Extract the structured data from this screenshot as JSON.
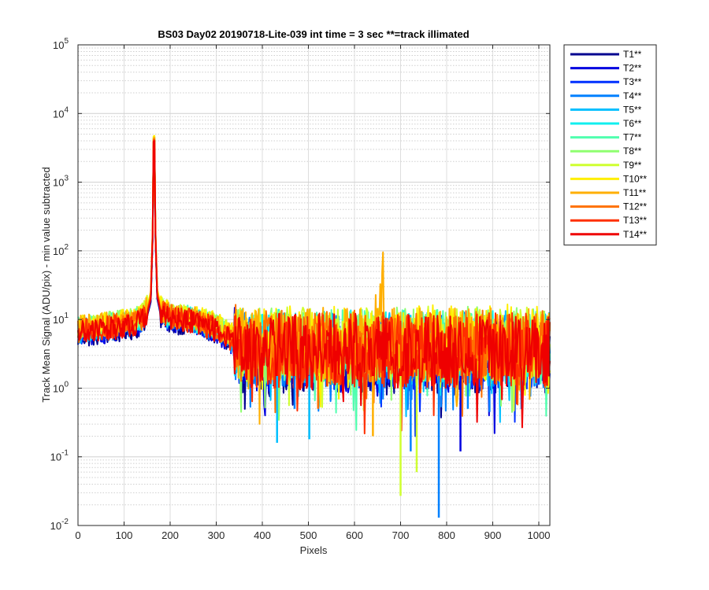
{
  "chart_data": {
    "type": "line",
    "title": "BS03 Day02 20190718-Lite-039 int time = 3 sec    **=track illimated",
    "xlabel": "Pixels",
    "ylabel": "Track Mean Signal (ADU/pix) - min value subtracted",
    "xlim": [
      0,
      1024
    ],
    "ylim": [
      0.01,
      100000
    ],
    "yscale": "log",
    "grid": "major and minor",
    "legend_position": "outside-top-right",
    "x_ticks": [
      0,
      100,
      200,
      300,
      400,
      500,
      600,
      700,
      800,
      900,
      1000
    ],
    "y_ticks": [
      {
        "value": 0.01,
        "base": "10",
        "exp": "-2"
      },
      {
        "value": 0.1,
        "base": "10",
        "exp": "-1"
      },
      {
        "value": 1,
        "base": "10",
        "exp": "0"
      },
      {
        "value": 10,
        "base": "10",
        "exp": "1"
      },
      {
        "value": 100,
        "base": "10",
        "exp": "2"
      },
      {
        "value": 1000,
        "base": "10",
        "exp": "3"
      },
      {
        "value": 10000,
        "base": "10",
        "exp": "4"
      },
      {
        "value": 100000,
        "base": "10",
        "exp": "5"
      }
    ],
    "x": [
      0,
      25,
      50,
      75,
      100,
      125,
      140,
      150,
      158,
      162,
      165,
      168,
      172,
      180,
      190,
      200,
      225,
      250,
      275,
      300,
      320,
      340,
      350,
      360,
      380,
      400,
      430,
      460,
      490,
      520,
      550,
      580,
      610,
      640,
      663,
      665,
      667,
      690,
      720,
      750,
      780,
      810,
      840,
      870,
      900,
      930,
      960,
      990,
      1024
    ],
    "series": [
      {
        "name": "T1**",
        "color": "#00008f",
        "values": [
          5.8,
          6.0,
          6.3,
          6.7,
          7.0,
          7.8,
          9.0,
          11.0,
          18,
          150,
          17000,
          160,
          20,
          11.0,
          10.0,
          9.2,
          9.0,
          8.5,
          7.5,
          6.5,
          5.2,
          4.0,
          3.2,
          3.0,
          2.8,
          3.0,
          2.9,
          3.1,
          2.8,
          3.0,
          2.9,
          2.8,
          3.0,
          2.7,
          2.9,
          3.0,
          2.8,
          2.9,
          2.8,
          2.9,
          3.0,
          2.8,
          3.0,
          2.9,
          3.0,
          3.1,
          2.9,
          3.0,
          2.9
        ]
      },
      {
        "name": "T2**",
        "color": "#0000df",
        "values": [
          6.0,
          6.2,
          6.6,
          7.0,
          7.4,
          8.2,
          9.4,
          11.5,
          19,
          160,
          18000,
          170,
          21,
          11.5,
          10.4,
          9.6,
          9.3,
          8.8,
          7.8,
          6.8,
          5.4,
          4.2,
          3.4,
          3.2,
          3.0,
          3.2,
          3.1,
          3.3,
          3.0,
          3.2,
          3.1,
          3.0,
          3.2,
          2.9,
          3.1,
          3.2,
          3.0,
          3.1,
          3.0,
          3.1,
          3.2,
          3.0,
          3.2,
          3.1,
          3.2,
          3.3,
          3.1,
          3.2,
          3.1
        ]
      },
      {
        "name": "T3**",
        "color": "#0030ff",
        "values": [
          6.2,
          6.5,
          6.9,
          7.3,
          7.7,
          8.5,
          9.8,
          12.0,
          20,
          170,
          19000,
          180,
          22,
          12.0,
          10.8,
          10.0,
          9.7,
          9.1,
          8.0,
          7.0,
          5.6,
          4.4,
          3.6,
          3.4,
          3.2,
          3.4,
          3.3,
          3.5,
          3.2,
          3.4,
          3.3,
          3.2,
          3.4,
          3.1,
          3.3,
          3.4,
          3.2,
          3.3,
          3.2,
          3.3,
          3.4,
          3.2,
          3.4,
          3.3,
          3.4,
          3.5,
          3.3,
          3.4,
          3.3
        ]
      },
      {
        "name": "T4**",
        "color": "#0080ff",
        "values": [
          6.5,
          6.8,
          7.2,
          7.6,
          8.0,
          8.8,
          10.2,
          12.5,
          21,
          175,
          19500,
          185,
          23,
          12.5,
          11.2,
          10.4,
          10.0,
          9.4,
          8.3,
          7.2,
          5.8,
          4.6,
          3.8,
          3.6,
          3.4,
          3.6,
          3.5,
          3.7,
          3.4,
          3.6,
          3.5,
          3.4,
          3.6,
          3.3,
          3.5,
          3.6,
          3.4,
          3.5,
          3.4,
          3.5,
          3.6,
          3.4,
          3.6,
          3.5,
          3.6,
          3.7,
          3.5,
          3.6,
          3.5
        ]
      },
      {
        "name": "T5**",
        "color": "#00bfff",
        "values": [
          6.8,
          7.1,
          7.5,
          7.9,
          8.3,
          9.1,
          10.6,
          13.0,
          22,
          180,
          20000,
          190,
          24,
          13.0,
          11.6,
          10.8,
          10.3,
          9.7,
          8.5,
          7.4,
          6.0,
          4.8,
          4.0,
          3.8,
          3.6,
          3.8,
          3.7,
          3.9,
          3.6,
          3.8,
          3.7,
          3.6,
          3.8,
          3.5,
          3.7,
          3.8,
          3.6,
          3.7,
          3.6,
          3.7,
          3.8,
          3.6,
          3.8,
          3.7,
          3.8,
          3.9,
          3.7,
          3.8,
          3.7
        ]
      },
      {
        "name": "T6**",
        "color": "#10efef",
        "values": [
          7.0,
          7.4,
          7.8,
          8.2,
          8.6,
          9.4,
          11.0,
          13.5,
          23,
          185,
          20500,
          195,
          25,
          13.5,
          12.0,
          11.2,
          10.6,
          10.0,
          8.8,
          7.6,
          6.2,
          5.0,
          4.2,
          4.0,
          3.8,
          4.0,
          3.9,
          4.1,
          3.8,
          4.0,
          3.9,
          3.8,
          4.0,
          3.7,
          3.9,
          4.0,
          3.8,
          3.9,
          3.8,
          3.9,
          4.0,
          3.8,
          4.0,
          3.9,
          4.0,
          4.1,
          3.9,
          4.0,
          3.9
        ]
      },
      {
        "name": "T7**",
        "color": "#50ffaf",
        "values": [
          7.3,
          7.7,
          8.1,
          8.5,
          8.9,
          9.7,
          11.4,
          14.0,
          24,
          190,
          21000,
          200,
          26,
          14.0,
          12.4,
          11.6,
          11.0,
          10.3,
          9.0,
          7.8,
          6.4,
          5.2,
          4.4,
          4.2,
          4.0,
          4.2,
          4.1,
          4.3,
          4.0,
          4.2,
          4.1,
          4.0,
          4.2,
          3.9,
          4.1,
          4.2,
          4.0,
          4.1,
          4.0,
          4.1,
          4.2,
          4.0,
          4.2,
          4.1,
          4.2,
          4.3,
          4.1,
          4.2,
          4.1
        ]
      },
      {
        "name": "T8**",
        "color": "#8fff70",
        "values": [
          7.6,
          8.0,
          8.4,
          8.8,
          9.2,
          10.0,
          11.8,
          14.5,
          25,
          195,
          21500,
          205,
          27,
          14.5,
          12.8,
          12.0,
          11.3,
          10.6,
          9.3,
          8.0,
          6.6,
          5.4,
          4.6,
          4.4,
          4.2,
          4.4,
          4.3,
          4.5,
          4.2,
          4.4,
          4.3,
          4.2,
          4.4,
          4.1,
          4.3,
          4.4,
          4.2,
          4.3,
          4.2,
          4.3,
          4.4,
          4.2,
          4.4,
          4.3,
          4.4,
          4.5,
          4.3,
          4.4,
          4.3
        ]
      },
      {
        "name": "T9**",
        "color": "#cfff30",
        "values": [
          7.8,
          8.2,
          8.6,
          9.0,
          9.4,
          10.2,
          12.0,
          14.8,
          25,
          198,
          22000,
          208,
          27,
          14.8,
          13.0,
          12.2,
          11.5,
          10.8,
          9.5,
          8.2,
          6.8,
          5.5,
          4.7,
          4.5,
          4.3,
          4.5,
          4.4,
          4.6,
          4.3,
          4.5,
          4.4,
          4.3,
          4.5,
          4.2,
          4.4,
          4.5,
          4.3,
          4.4,
          4.3,
          4.4,
          4.5,
          4.3,
          4.5,
          4.4,
          4.5,
          4.6,
          4.4,
          4.5,
          4.4
        ]
      },
      {
        "name": "T10**",
        "color": "#ffef00",
        "values": [
          8.0,
          8.4,
          8.8,
          9.2,
          9.6,
          10.4,
          12.2,
          15.0,
          26,
          200,
          22500,
          210,
          28,
          15.0,
          13.2,
          12.4,
          11.7,
          11.0,
          9.7,
          8.4,
          7.0,
          5.6,
          4.8,
          4.6,
          4.4,
          4.6,
          4.5,
          4.7,
          4.4,
          4.6,
          4.5,
          4.4,
          4.6,
          4.3,
          4.5,
          4.6,
          4.4,
          4.5,
          4.4,
          4.5,
          4.6,
          4.4,
          4.6,
          4.5,
          4.6,
          4.7,
          4.5,
          4.6,
          4.5
        ]
      },
      {
        "name": "T11**",
        "color": "#ffaf00",
        "values": [
          7.5,
          7.9,
          8.3,
          8.7,
          9.1,
          9.9,
          11.6,
          14.2,
          24,
          192,
          21000,
          202,
          26,
          14.2,
          12.6,
          11.8,
          11.2,
          10.5,
          9.2,
          7.9,
          6.5,
          5.3,
          4.5,
          4.3,
          4.1,
          4.3,
          4.2,
          4.4,
          4.1,
          4.3,
          4.2,
          4.1,
          4.3,
          4.0,
          42,
          4.3,
          4.1,
          4.2,
          4.1,
          4.2,
          4.3,
          4.1,
          4.3,
          4.2,
          4.3,
          4.4,
          4.2,
          4.3,
          4.2
        ]
      },
      {
        "name": "T12**",
        "color": "#ff7000",
        "values": [
          7.0,
          7.3,
          7.7,
          8.1,
          8.5,
          9.3,
          10.8,
          13.2,
          22,
          182,
          20000,
          192,
          24,
          13.2,
          11.8,
          11.0,
          10.5,
          9.9,
          8.7,
          7.5,
          6.1,
          4.9,
          4.1,
          3.9,
          3.7,
          3.9,
          3.8,
          4.0,
          3.7,
          3.9,
          3.8,
          3.7,
          3.9,
          3.6,
          3.8,
          3.9,
          3.7,
          3.8,
          3.7,
          3.8,
          3.9,
          3.7,
          3.9,
          3.8,
          3.9,
          4.0,
          3.8,
          3.9,
          3.8
        ]
      },
      {
        "name": "T13**",
        "color": "#ff3000",
        "values": [
          6.6,
          6.9,
          7.3,
          7.7,
          8.1,
          8.9,
          10.3,
          12.6,
          21,
          176,
          19000,
          186,
          23,
          12.6,
          11.3,
          10.5,
          10.1,
          9.5,
          8.4,
          7.3,
          5.9,
          4.7,
          3.9,
          3.7,
          3.5,
          3.7,
          3.6,
          3.8,
          3.5,
          3.7,
          3.6,
          3.5,
          3.7,
          3.4,
          3.6,
          3.7,
          3.5,
          3.6,
          3.5,
          3.6,
          3.7,
          3.5,
          3.7,
          3.6,
          3.7,
          3.8,
          3.6,
          3.7,
          3.6
        ]
      },
      {
        "name": "T14**",
        "color": "#ef0000",
        "values": [
          6.3,
          6.6,
          7.0,
          7.4,
          7.8,
          8.6,
          10.0,
          12.2,
          20,
          172,
          18500,
          182,
          22,
          12.2,
          11.0,
          10.2,
          9.8,
          9.3,
          8.2,
          7.1,
          5.7,
          4.5,
          3.7,
          3.5,
          3.3,
          3.5,
          3.4,
          3.6,
          3.3,
          3.5,
          3.4,
          3.3,
          3.5,
          3.2,
          3.4,
          3.5,
          3.3,
          3.4,
          3.3,
          3.4,
          3.5,
          3.3,
          3.5,
          3.4,
          3.5,
          3.6,
          3.4,
          3.5,
          3.4
        ]
      }
    ],
    "annotations": [
      {
        "x": 165,
        "value": 20000,
        "note": "main peak"
      },
      {
        "x": 665,
        "value": 42,
        "note": "secondary spike"
      }
    ],
    "dips": [
      {
        "x": 432,
        "value": 0.16,
        "color": "#00bfff"
      },
      {
        "x": 470,
        "value": 0.5,
        "color": "#0080ff"
      },
      {
        "x": 502,
        "value": 0.18,
        "color": "#00bfff"
      },
      {
        "x": 521,
        "value": 0.5,
        "color": "#ff7000"
      },
      {
        "x": 640,
        "value": 0.2,
        "color": "#ffaf00"
      },
      {
        "x": 700,
        "value": 0.027,
        "color": "#cfff30"
      },
      {
        "x": 722,
        "value": 0.12,
        "color": "#0080ff"
      },
      {
        "x": 735,
        "value": 0.06,
        "color": "#cfff30"
      },
      {
        "x": 783,
        "value": 0.013,
        "color": "#0080ff"
      },
      {
        "x": 830,
        "value": 0.12,
        "color": "#0000df"
      },
      {
        "x": 846,
        "value": 0.5,
        "color": "#0080ff"
      },
      {
        "x": 893,
        "value": 0.45,
        "color": "#0080ff"
      }
    ]
  }
}
